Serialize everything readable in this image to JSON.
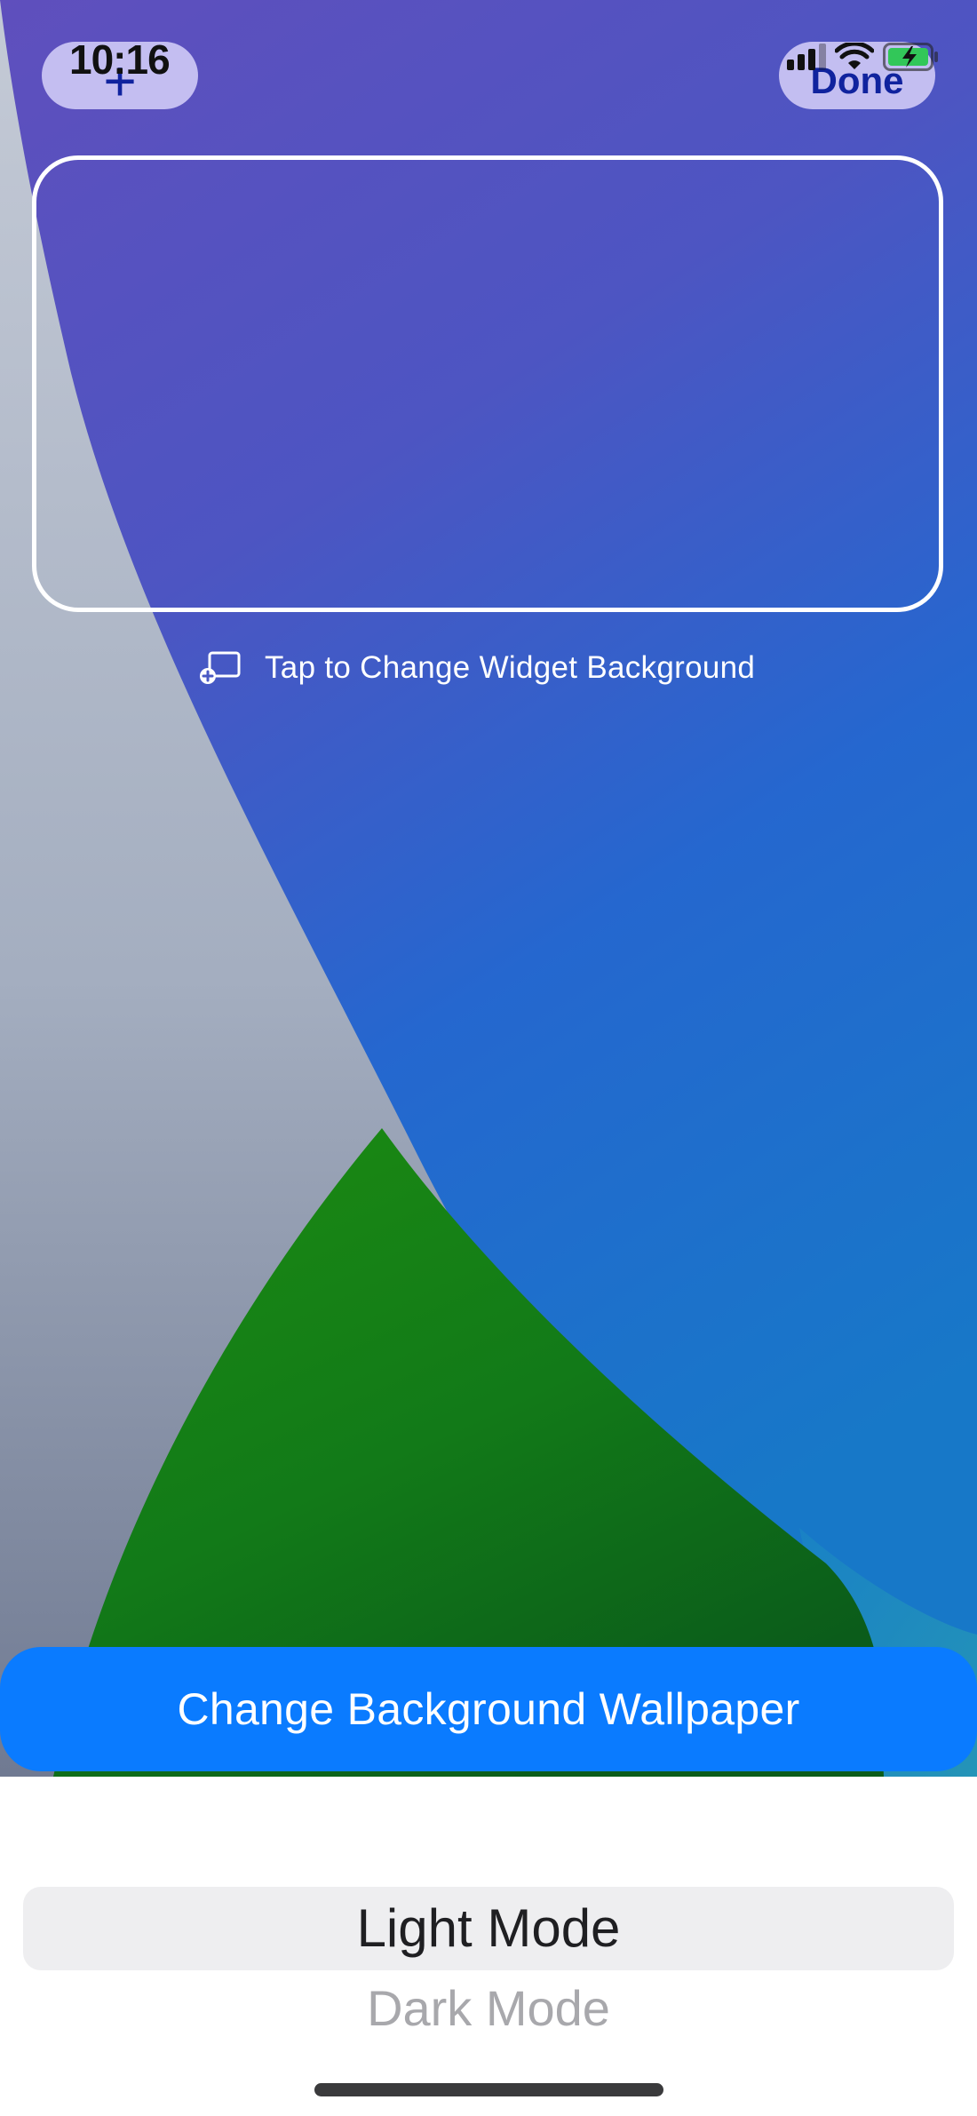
{
  "status_bar": {
    "time": "10:16",
    "icons": [
      "cellular-signal-icon",
      "wifi-icon",
      "battery-charging-icon"
    ]
  },
  "toolbar": {
    "add_icon": "+",
    "done_label": "Done"
  },
  "widget": {
    "hint_label": "Tap to Change Widget Background",
    "hint_icon": "add-background-icon"
  },
  "actions": {
    "change_wallpaper_label": "Change Background Wallpaper"
  },
  "mode_picker": {
    "options": [
      "Light Mode",
      "Dark Mode"
    ],
    "selected": "Light Mode"
  },
  "colors": {
    "accent": "#0a7bff",
    "wallpaper_purple": "#5d4fbb",
    "wallpaper_blue": "#1a72cf",
    "wallpaper_green": "#1e8a12",
    "pill_bg": "#cdc8f5",
    "pill_text": "#10239e"
  }
}
